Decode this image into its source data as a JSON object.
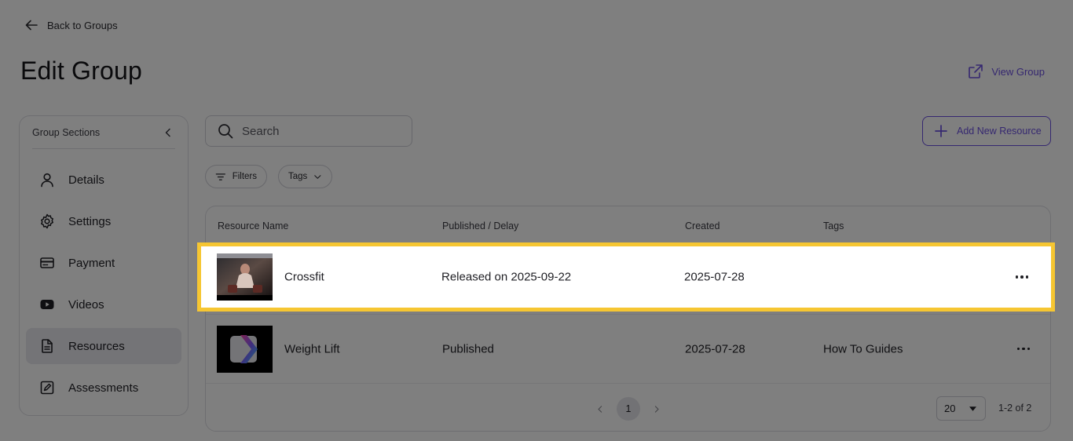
{
  "header": {
    "back_label": "Back to Groups",
    "title": "Edit Group",
    "view_group_label": "View Group"
  },
  "sidebar": {
    "title": "Group Sections",
    "items": [
      {
        "label": "Details",
        "icon": "user-icon"
      },
      {
        "label": "Settings",
        "icon": "gear-icon"
      },
      {
        "label": "Payment",
        "icon": "credit-card-icon"
      },
      {
        "label": "Videos",
        "icon": "youtube-icon"
      },
      {
        "label": "Resources",
        "icon": "document-icon",
        "active": true
      },
      {
        "label": "Assessments",
        "icon": "edit-box-icon"
      }
    ]
  },
  "toolbar": {
    "search_placeholder": "Search",
    "add_label": "Add New Resource",
    "filters_label": "Filters",
    "tags_label": "Tags"
  },
  "table": {
    "columns": [
      "Resource Name",
      "Published / Delay",
      "Created",
      "Tags"
    ],
    "rows": [
      {
        "name": "Crossfit",
        "status": "Released on 2025-09-22",
        "created": "2025-07-28",
        "tags": "",
        "thumbnail": "gym-photo"
      },
      {
        "name": "Weight Lift",
        "status": "Published",
        "created": "2025-07-28",
        "tags": "How To Guides",
        "thumbnail": "logo-on-black"
      }
    ]
  },
  "pagination": {
    "current_page": "1",
    "page_size": "20",
    "range": "1-2 of 2"
  },
  "colors": {
    "accent": "#6a4fe0",
    "highlight": "#f6c632"
  }
}
